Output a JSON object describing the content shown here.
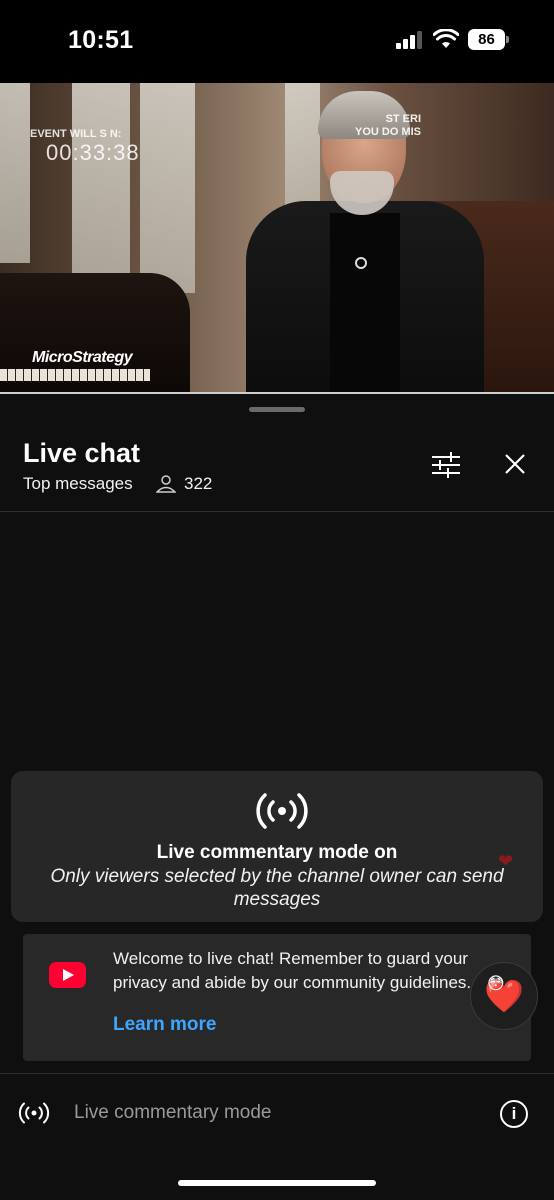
{
  "status_bar": {
    "time": "10:51",
    "battery": "86"
  },
  "video": {
    "overlay_event": "EVENT WILL S     N:",
    "overlay_countdown": "00:33:38",
    "overlay_right_line1": "ST     ERI",
    "overlay_right_line2": "YOU DO     MIS",
    "brand": "MicroStrategy"
  },
  "chat": {
    "title": "Live chat",
    "subtitle": "Top messages",
    "viewer_count": "322",
    "icons": {
      "filter": "sliders-icon",
      "close": "close-icon",
      "viewers": "person-icon"
    }
  },
  "commentary_notice": {
    "icon": "broadcast-icon",
    "title": "Live commentary mode on",
    "description": "Only viewers selected by the channel owner can send messages"
  },
  "welcome": {
    "icon": "youtube-icon",
    "text": "Welcome to live chat! Remember to guard your privacy and abide by our community guidelines.",
    "learn_more": "Learn more"
  },
  "reactions": {
    "heart": "❤️",
    "small_heart": "❤",
    "flushed": "😳"
  },
  "input_bar": {
    "placeholder": "Live commentary mode",
    "info_glyph": "i"
  },
  "colors": {
    "background": "#0f0f0f",
    "card": "#272727",
    "link": "#3ea6ff",
    "youtube_red": "#ff0033",
    "heart": "#ff2a4b"
  }
}
